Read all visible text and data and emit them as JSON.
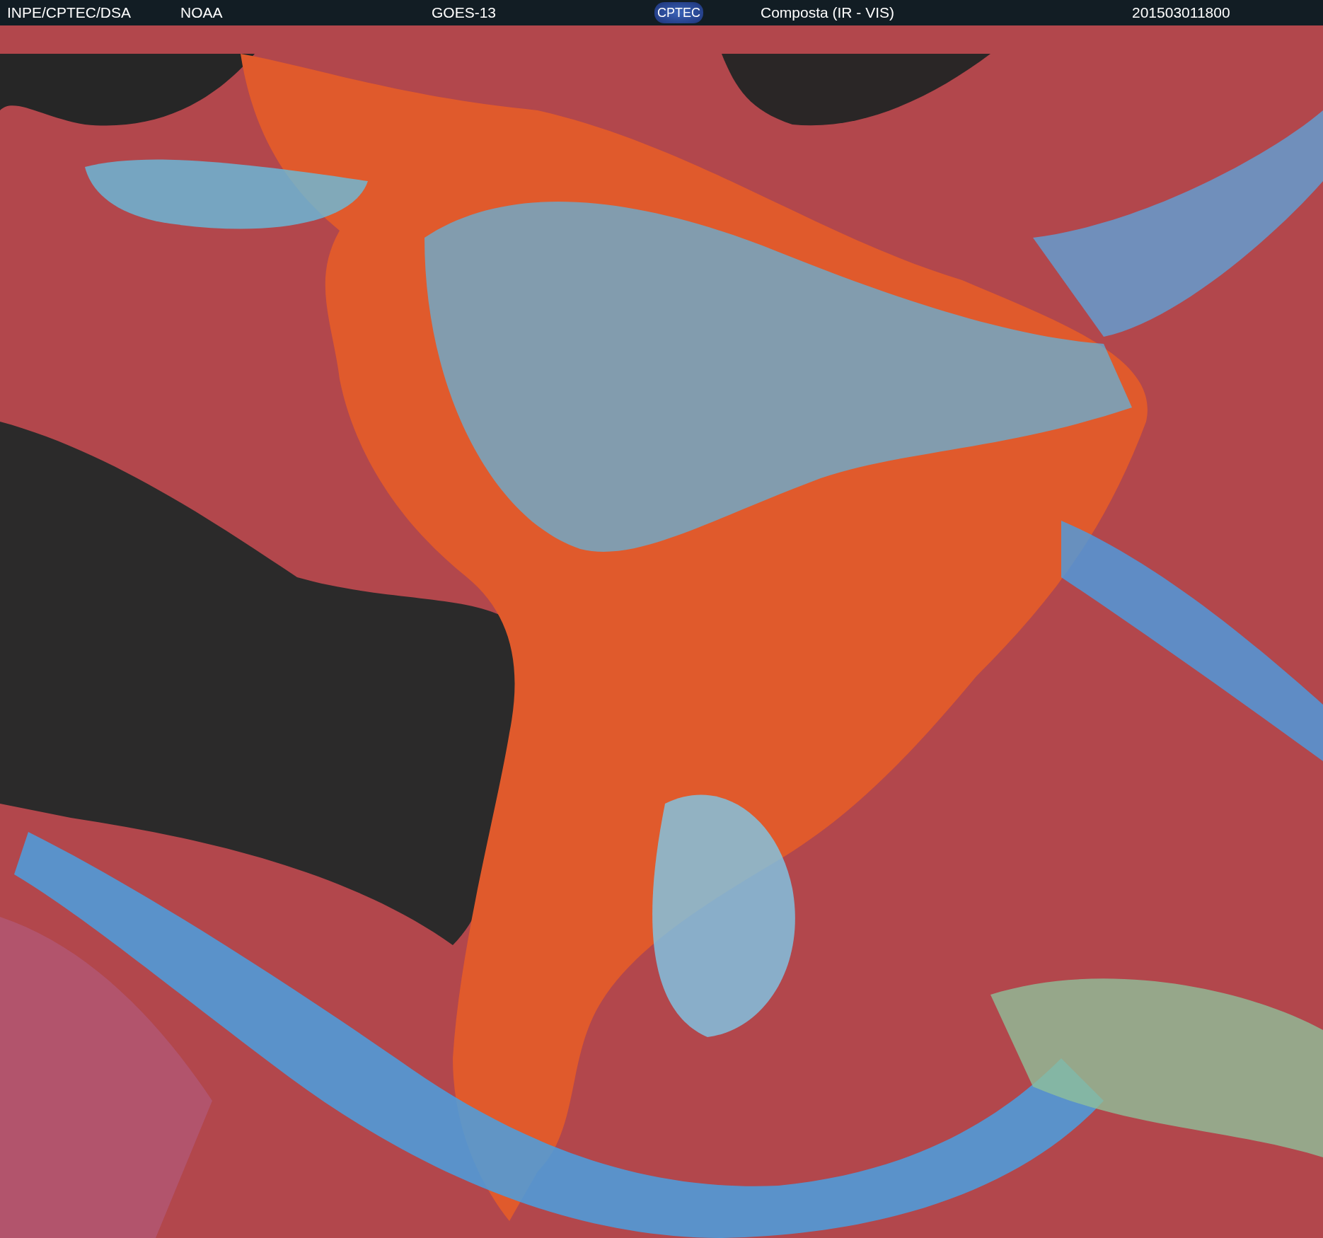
{
  "header": {
    "source": "INPE/CPTEC/DSA",
    "agency": "NOAA",
    "satellite": "GOES-13",
    "logo": "CPTEC",
    "product": "Composta (IR - VIS)",
    "timestamp": "201503011800"
  }
}
